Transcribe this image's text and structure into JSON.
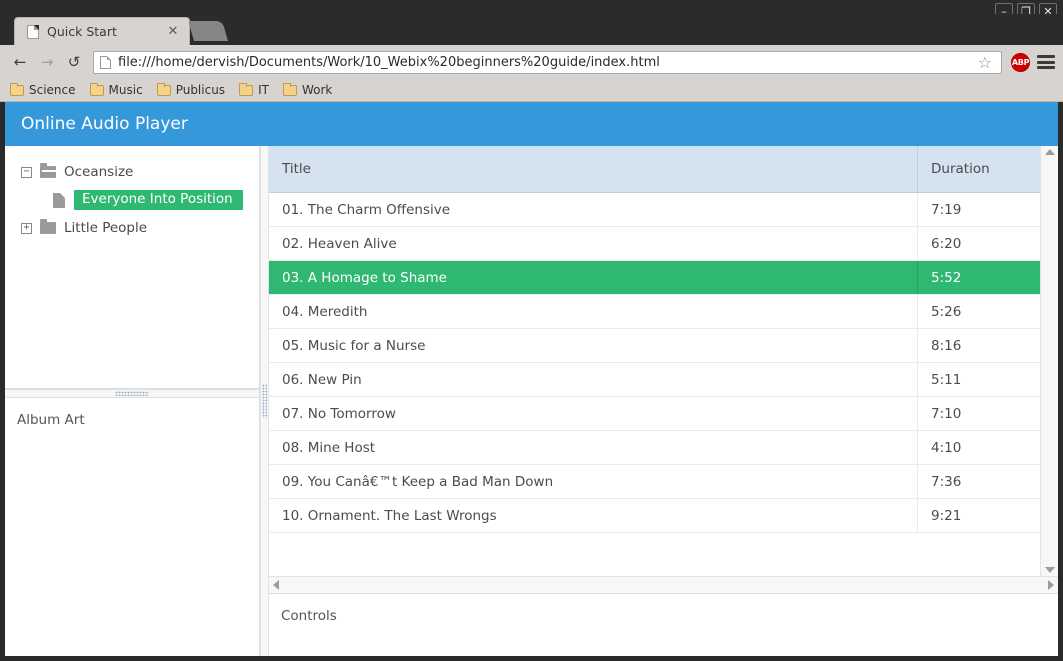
{
  "window": {
    "minimize_label": "–",
    "maximize_label": "❐",
    "close_label": "✕"
  },
  "browser": {
    "tab": {
      "title": "Quick Start",
      "close_label": "✕"
    },
    "nav": {
      "back_label": "←",
      "forward_label": "→",
      "reload_label": "↺"
    },
    "url": "file:///home/dervish/Documents/Work/10_Webix%20beginners%20guide/index.html",
    "star_label": "☆",
    "abp_label": "ABP",
    "bookmarks": [
      {
        "label": "Science"
      },
      {
        "label": "Music"
      },
      {
        "label": "Publicus"
      },
      {
        "label": "IT"
      },
      {
        "label": "Work"
      }
    ]
  },
  "app": {
    "title": "Online Audio Player",
    "accent_blue": "#3498db",
    "accent_green": "#2eb872",
    "header_blue": "#d5e2ef",
    "tree": {
      "items": [
        {
          "label": "Oceansize",
          "toggler": "−",
          "icon": "folder-open-icon",
          "level": 0,
          "selected": false
        },
        {
          "label": "Everyone Into Position",
          "toggler": "",
          "icon": "file-icon",
          "level": 1,
          "selected": true
        },
        {
          "label": "Little People",
          "toggler": "+",
          "icon": "folder-closed-icon",
          "level": 0,
          "selected": false
        }
      ]
    },
    "album_art": {
      "label": "Album Art"
    },
    "controls": {
      "label": "Controls"
    },
    "grid": {
      "columns": [
        {
          "label": "Title",
          "key": "title"
        },
        {
          "label": "Duration",
          "key": "duration"
        }
      ],
      "rows": [
        {
          "title": "01. The Charm Offensive",
          "duration": "7:19",
          "selected": false
        },
        {
          "title": "02. Heaven Alive",
          "duration": "6:20",
          "selected": false
        },
        {
          "title": "03. A Homage to Shame",
          "duration": "5:52",
          "selected": true
        },
        {
          "title": "04. Meredith",
          "duration": "5:26",
          "selected": false
        },
        {
          "title": "05. Music for a Nurse",
          "duration": "8:16",
          "selected": false
        },
        {
          "title": "06. New Pin",
          "duration": "5:11",
          "selected": false
        },
        {
          "title": "07. No Tomorrow",
          "duration": "7:10",
          "selected": false
        },
        {
          "title": "08. Mine Host",
          "duration": "4:10",
          "selected": false
        },
        {
          "title": "09. You Canâ€™t Keep a Bad Man Down",
          "duration": "7:36",
          "selected": false
        },
        {
          "title": "10. Ornament. The Last Wrongs",
          "duration": "9:21",
          "selected": false
        }
      ]
    }
  }
}
